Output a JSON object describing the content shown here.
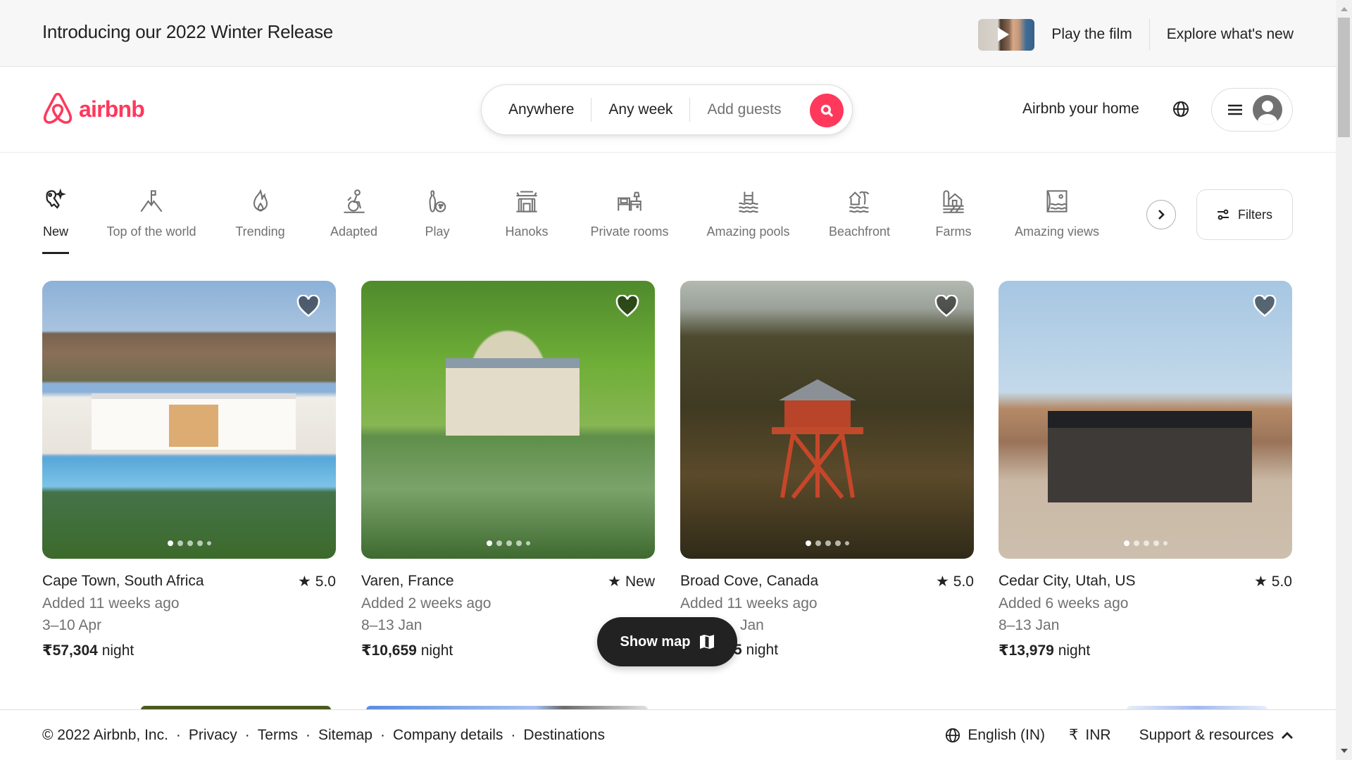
{
  "banner": {
    "title": "Introducing our 2022 Winter Release",
    "play_film": "Play the film",
    "explore": "Explore what's new"
  },
  "header": {
    "logo_text": "airbnb",
    "search": {
      "where": "Anywhere",
      "when": "Any week",
      "guests_placeholder": "Add guests"
    },
    "host_link": "Airbnb your home"
  },
  "categories": {
    "items": [
      {
        "label": "New",
        "icon": "new-key-sparkle-icon",
        "active": true
      },
      {
        "label": "Top of the world",
        "icon": "mountain-flag-icon"
      },
      {
        "label": "Trending",
        "icon": "flame-icon"
      },
      {
        "label": "Adapted",
        "icon": "wheelchair-icon"
      },
      {
        "label": "Play",
        "icon": "bowling-icon"
      },
      {
        "label": "Hanoks",
        "icon": "hanok-house-icon"
      },
      {
        "label": "Private rooms",
        "icon": "bed-lamp-icon"
      },
      {
        "label": "Amazing pools",
        "icon": "pool-icon"
      },
      {
        "label": "Beachfront",
        "icon": "beach-hut-icon"
      },
      {
        "label": "Farms",
        "icon": "farm-barn-icon"
      },
      {
        "label": "Amazing views",
        "icon": "window-view-icon"
      }
    ],
    "filters_label": "Filters"
  },
  "listings": [
    {
      "title": "Cape Town, South Africa",
      "rating": "5.0",
      "added": "Added 11 weeks ago",
      "dates": "3–10 Apr",
      "price": "₹57,304",
      "price_unit": "night",
      "photo_count": 5,
      "photo_index": 1
    },
    {
      "title": "Varen, France",
      "rating": "New",
      "added": "Added 2 weeks ago",
      "dates": "8–13 Jan",
      "price": "₹10,659",
      "price_unit": "night",
      "photo_count": 5,
      "photo_index": 1
    },
    {
      "title": "Broad Cove, Canada",
      "rating": "5.0",
      "added": "Added 11 weeks ago",
      "dates": "Jan",
      "price": "5",
      "price_unit": "night",
      "photo_count": 5,
      "photo_index": 1
    },
    {
      "title": "Cedar City, Utah, US",
      "rating": "5.0",
      "added": "Added 6 weeks ago",
      "dates": "8–13 Jan",
      "price": "₹13,979",
      "price_unit": "night",
      "photo_count": 5,
      "photo_index": 1
    }
  ],
  "show_map_label": "Show map",
  "footer": {
    "copyright": "© 2022 Airbnb, Inc.",
    "links": [
      "Privacy",
      "Terms",
      "Sitemap",
      "Company details",
      "Destinations"
    ],
    "language": "English (IN)",
    "currency_symbol": "₹",
    "currency": "INR",
    "support": "Support & resources"
  },
  "colors": {
    "brand": "#ff385c",
    "text": "#222222",
    "muted": "#717171"
  }
}
